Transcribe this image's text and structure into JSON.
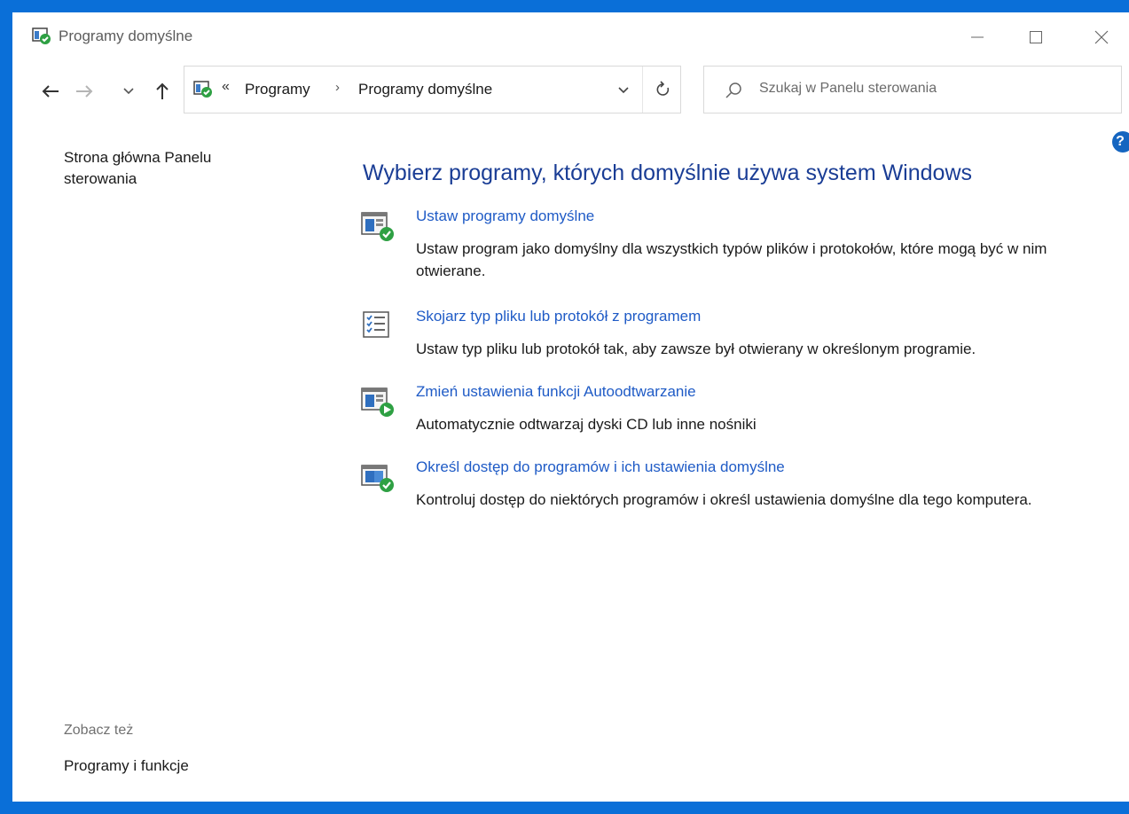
{
  "window": {
    "title": "Programy domyślne",
    "minimize_icon": "minimize-icon",
    "maximize_icon": "maximize-icon",
    "close_icon": "close-icon"
  },
  "nav": {
    "back_icon": "back-arrow-icon",
    "forward_icon": "forward-arrow-icon",
    "recent_icon": "chevron-down-icon",
    "up_icon": "up-arrow-icon"
  },
  "address": {
    "overflow": "«",
    "crumbs": [
      "Programy",
      "Programy domyślne"
    ],
    "separator": "›"
  },
  "search": {
    "placeholder": "Szukaj w Panelu sterowania"
  },
  "help": {
    "label": "?"
  },
  "left_pane": {
    "home_link": "Strona główna Panelu sterowania",
    "see_also": "Zobacz też",
    "programs_and_features": "Programy i funkcje"
  },
  "main": {
    "heading": "Wybierz programy, których domyślnie używa system Windows",
    "tasks": [
      {
        "link": "Ustaw programy domyślne",
        "desc": "Ustaw program jako domyślny dla wszystkich typów plików i protokołów, które mogą być w nim otwierane.",
        "icon": "default-programs-icon"
      },
      {
        "link": "Skojarz typ pliku lub protokół z programem",
        "desc": "Ustaw typ pliku lub protokół tak, aby zawsze był otwierany w określonym programie.",
        "icon": "file-association-icon"
      },
      {
        "link": "Zmień ustawienia funkcji Autoodtwarzanie",
        "desc": "Automatycznie odtwarzaj dyski CD lub inne nośniki",
        "icon": "autoplay-icon"
      },
      {
        "link": "Określ dostęp do programów i ich ustawienia domyślne",
        "desc": "Kontroluj dostęp do niektórych programów i określ ustawienia domyślne dla tego komputera.",
        "icon": "program-access-icon"
      }
    ]
  },
  "colors": {
    "frame": "#0a6fd8",
    "heading": "#1a3d95",
    "link": "#1f5bc6",
    "check_green": "#2ea043"
  }
}
